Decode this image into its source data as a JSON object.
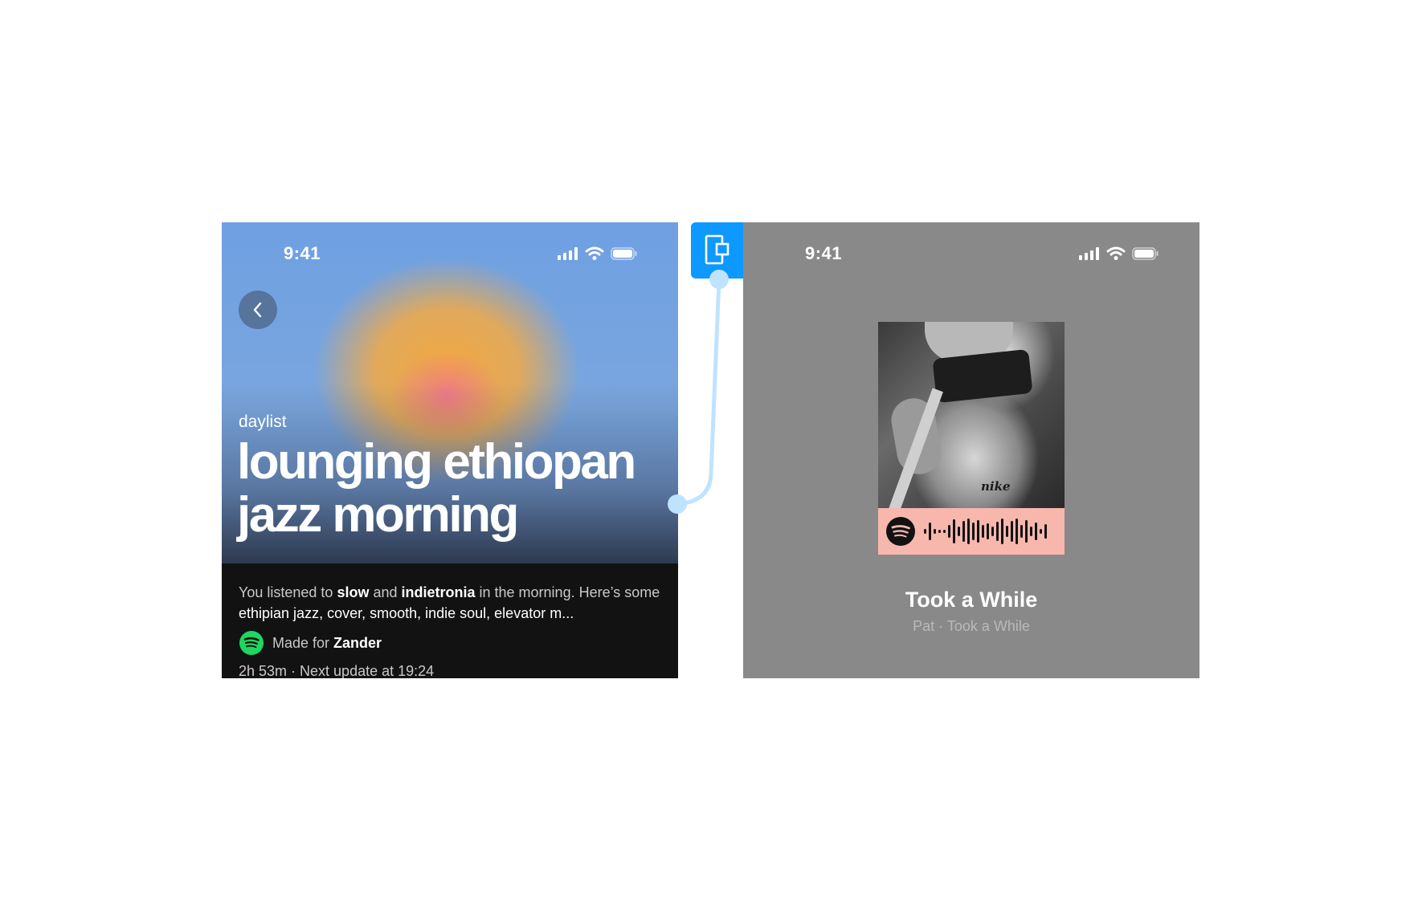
{
  "left_screen": {
    "status_time": "9:41",
    "back_icon": "chevron-left-icon",
    "tag": "daylist",
    "title": "lounging ethiopan jazz morning",
    "description": {
      "p1": "You listened to ",
      "genre1": "slow",
      "p2": " and ",
      "genre2": "indietronia",
      "p3": " in the morning. Here’s some ",
      "tags": "ethipian jazz, cover, smooth, indie soul, elevator m..."
    },
    "made_for_prefix": "Made for ",
    "made_for_user": "Zander",
    "meta": "2h 53m · Next update at 19:24"
  },
  "connector": {
    "icon": "prototype-connection-icon",
    "color": "#0d99ff",
    "line_color": "#bfe3ff"
  },
  "right_screen": {
    "status_time": "9:41",
    "track_title": "Took a While",
    "track_subtitle": "Pat · Took a While",
    "code_color": "#f7b7ad",
    "background": "#898989"
  },
  "colors": {
    "spotify_green": "#1ed760",
    "dark_panel": "#121212"
  }
}
